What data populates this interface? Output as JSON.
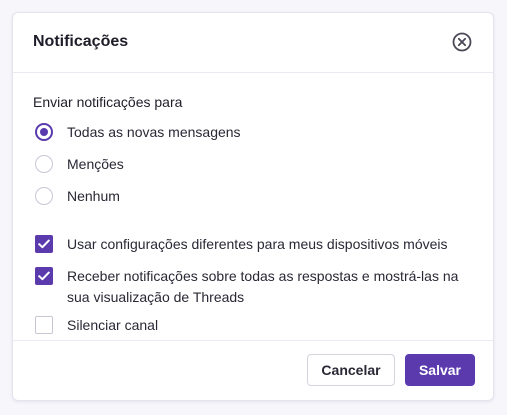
{
  "dialog": {
    "title": "Notificações",
    "close_icon": "close-circle-icon"
  },
  "notify_for": {
    "label": "Enviar notificações para",
    "options": [
      {
        "label": "Todas as novas mensagens",
        "selected": true
      },
      {
        "label": "Menções",
        "selected": false
      },
      {
        "label": "Nenhum",
        "selected": false
      }
    ]
  },
  "settings": [
    {
      "label": "Usar configurações diferentes para meus dispositivos móveis",
      "checked": true
    },
    {
      "label": "Receber notificações sobre todas as respostas e mostrá-las na sua visualização de Threads",
      "checked": true
    },
    {
      "label": "Silenciar canal",
      "checked": false
    }
  ],
  "footer": {
    "cancel_label": "Cancelar",
    "save_label": "Salvar"
  },
  "colors": {
    "accent": "#5b3aae",
    "border": "#c9c6d3",
    "text": "#1f1d29"
  }
}
